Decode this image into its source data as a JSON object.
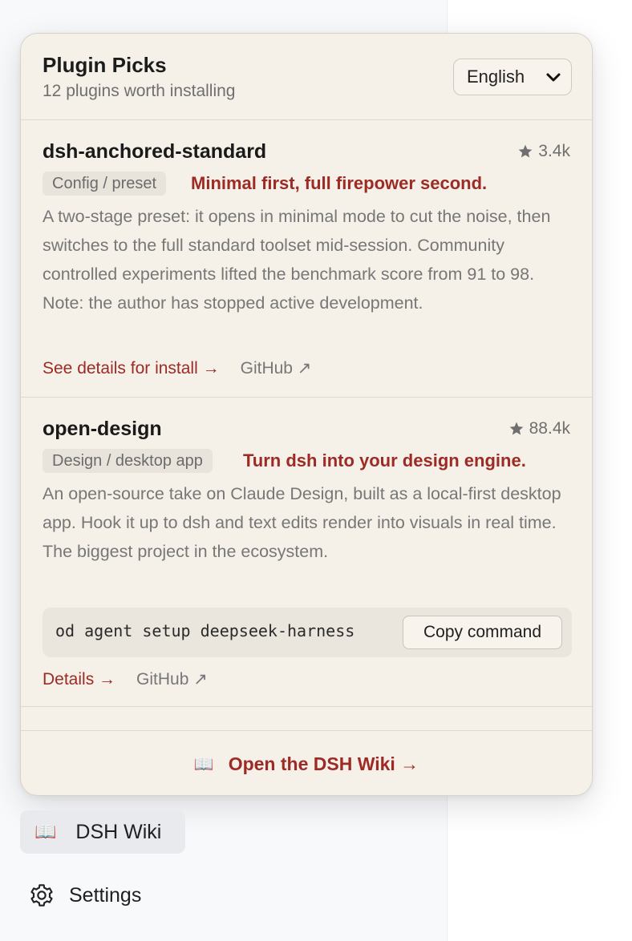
{
  "popover": {
    "title": "Plugin Picks",
    "subtitle": "12 plugins worth installing",
    "language": "English"
  },
  "plugins": [
    {
      "name": "dsh-anchored-standard",
      "stars": "3.4k",
      "tag": "Config / preset",
      "tagline": "Minimal first, full firepower second.",
      "description": "A two-stage preset: it opens in minimal mode to cut the noise, then switches to the full standard toolset mid-session. Community controlled experiments lifted the benchmark score from 91 to 98. Note: the author has stopped active development.",
      "primary_link": "See details for install →",
      "secondary_link": "GitHub ↗"
    },
    {
      "name": "open-design",
      "stars": "88.4k",
      "tag": "Design / desktop app",
      "tagline": "Turn dsh into your design engine.",
      "description": "An open-source take on Claude Design, built as a local-first desktop app. Hook it up to dsh and text edits render into visuals in real time. The biggest project in the ecosystem.",
      "command": "od agent setup deepseek-harness",
      "copy_label": "Copy command",
      "primary_link": "Details →",
      "secondary_link": "GitHub ↗"
    }
  ],
  "footer": {
    "icon": "📖",
    "link": "Open the DSH Wiki →"
  },
  "sidebar": {
    "wiki_icon": "📖",
    "wiki_label": "DSH Wiki",
    "settings_label": "Settings"
  },
  "colors": {
    "accent": "#9c2b25",
    "popover_bg": "#f5f0e8"
  }
}
